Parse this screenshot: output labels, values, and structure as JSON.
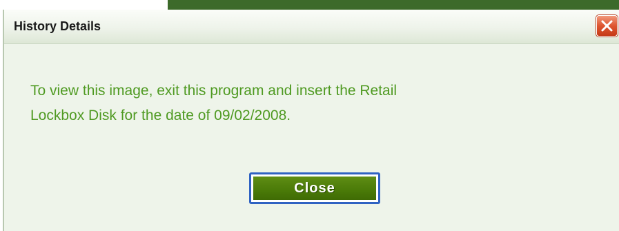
{
  "dialog": {
    "title": "History Details",
    "message": "To view this image, exit this program and insert the Retail\nLockbox Disk  for the date of 09/02/2008.",
    "close_button_label": "Close",
    "window_close_icon": "close-x-icon"
  },
  "colors": {
    "message_text": "#4f9a22",
    "button_fill": "#4a7a08",
    "button_focus_border": "#2f62c2",
    "window_close_red": "#de5530",
    "dialog_background": "#eef4ea"
  }
}
